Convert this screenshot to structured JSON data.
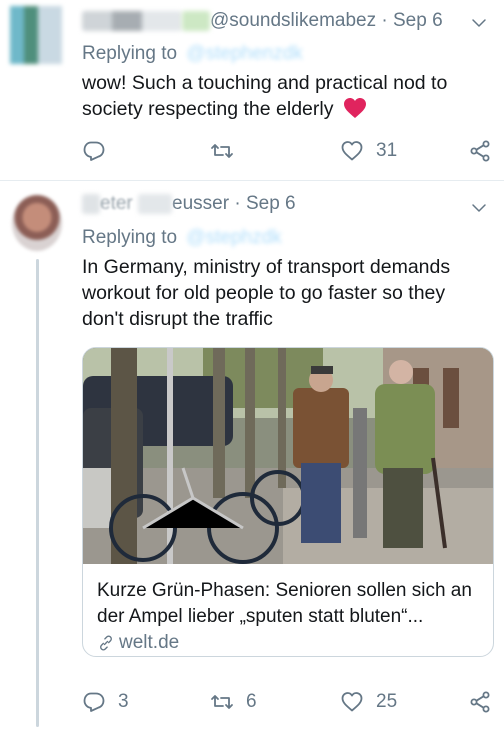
{
  "tweet1": {
    "handle_suffix": "@soundslikemabez",
    "time": "Sep 6",
    "replying_prefix": "Replying to",
    "replying_handle": "@stephenzdk",
    "text": "wow! Such a touching and practical nod to society respecting the elderly",
    "emoji": "red-heart",
    "reply_count": "",
    "retweet_count": "",
    "like_count": "31"
  },
  "tweet2": {
    "name_visible": "eter",
    "handle_visible": "eusser",
    "time": "Sep 6",
    "replying_prefix": "Replying to",
    "replying_handle": "@stephzdk",
    "text": "In Germany, ministry of transport demands workout for old people to go faster so they don't disrupt the traffic",
    "card": {
      "title": "Kurze Grün-Phasen: Senioren sollen sich an der Ampel lieber „sputen statt bluten“...",
      "domain": "welt.de"
    },
    "reply_count": "3",
    "retweet_count": "6",
    "like_count": "25"
  },
  "icons": [
    "chevron-down-icon",
    "reply-icon",
    "retweet-icon",
    "like-icon",
    "share-icon",
    "link-icon"
  ],
  "colors": {
    "secondary_text": "#657786",
    "primary_text": "#14171a",
    "heart_emoji": "#e0245e",
    "divider": "#e6ecf0"
  }
}
